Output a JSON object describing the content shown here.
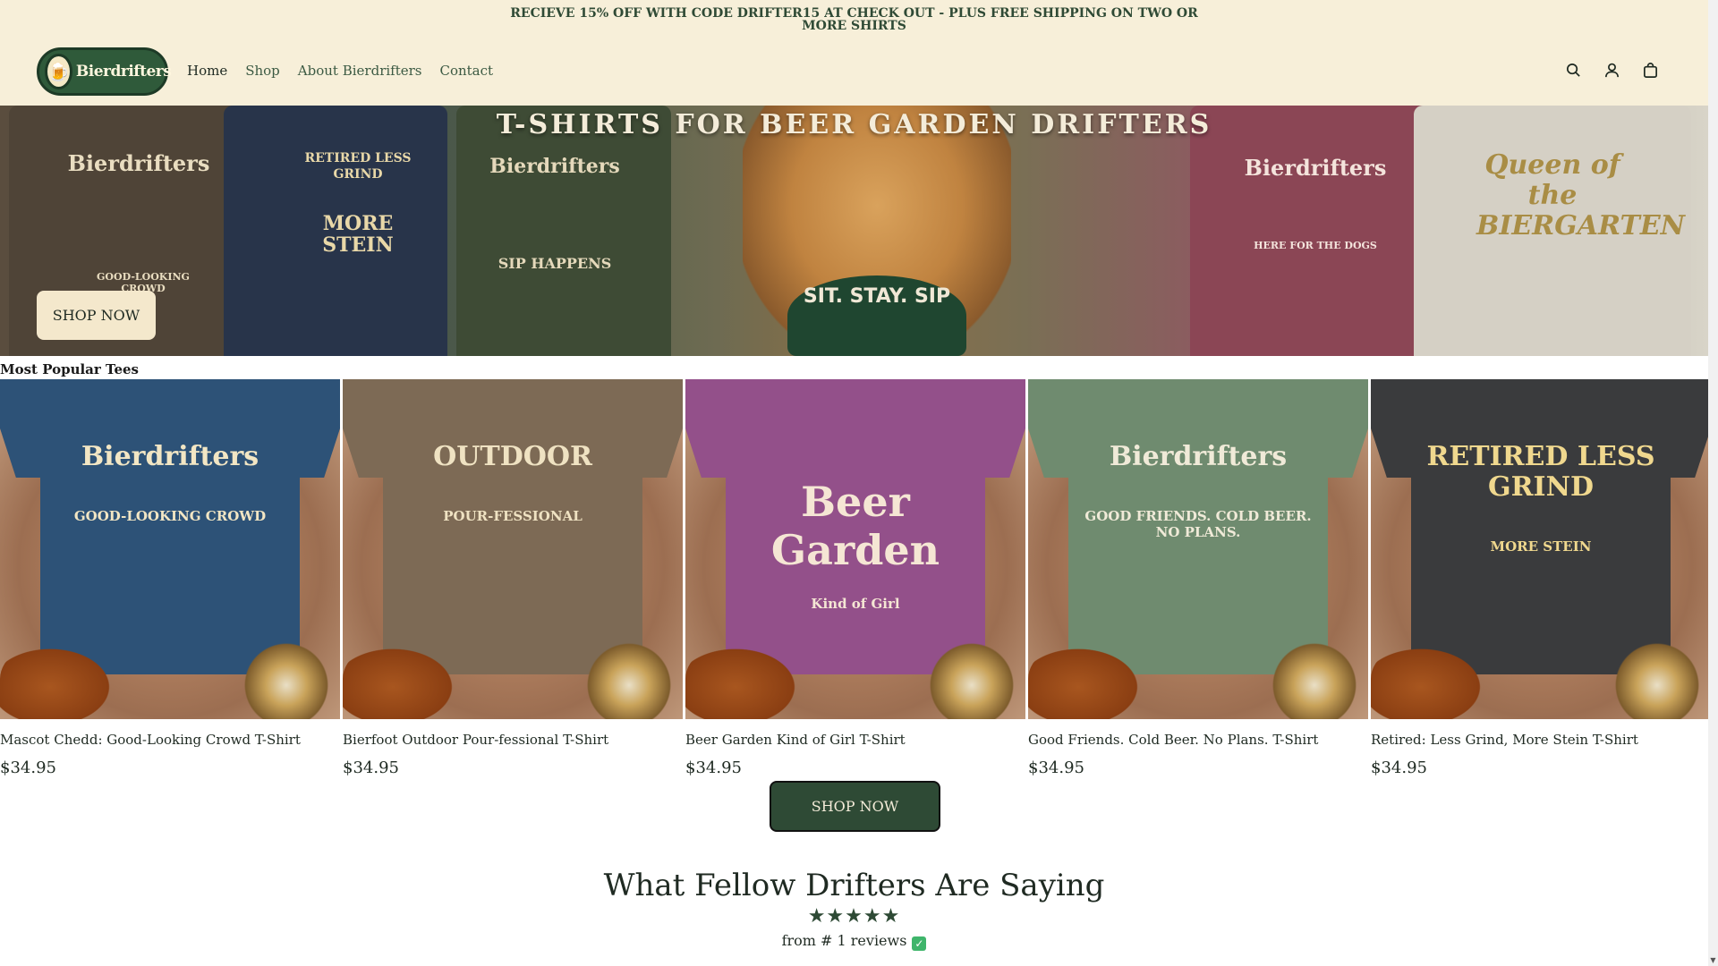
{
  "announcement": {
    "line1": "RECIEVE 15% OFF WITH CODE DRIFTER15 AT CHECK OUT - PLUS FREE SHIPPING ON TWO OR",
    "line2": "MORE SHIRTS"
  },
  "header": {
    "logo_text": "Bierdrifters",
    "nav": [
      {
        "label": "Home",
        "active": true
      },
      {
        "label": "Shop",
        "active": false
      },
      {
        "label": "About Bierdrifters",
        "active": false
      },
      {
        "label": "Contact",
        "active": false
      }
    ],
    "icons": [
      "search-icon",
      "account-icon",
      "cart-icon"
    ]
  },
  "hero": {
    "title": "T-SHIRTS FOR BEER GARDEN DRIFTERS",
    "button_label": "SHOP NOW",
    "shirt_prints": {
      "shirt1_top": "Bierdrifters",
      "shirt1_bottom": "GOOD-LOOKING CROWD",
      "shirt2_top": "RETIRED LESS GRIND",
      "shirt2_bottom": "MORE STEIN",
      "shirt3_top": "Bierdrifters",
      "shirt3_bottom": "SIP HAPPENS",
      "dog_scarf": "SIT. STAY. SIP",
      "shirt4_top": "Bierdrifters",
      "shirt4_bottom": "HERE FOR THE DOGS",
      "shirt5": "Queen of the BIERGARTEN"
    }
  },
  "products_section": {
    "title": "Most Popular Tees",
    "products": [
      {
        "name": "Mascot Chedd: Good-Looking Crowd T-Shirt",
        "price": "$34.95",
        "shirt_color": "#2d5277",
        "print_color": "#f2e6c4",
        "print_a": "Bierdrifters",
        "print_b": "",
        "print_c": "GOOD-LOOKING CROWD"
      },
      {
        "name": "Bierfoot Outdoor Pour-fessional T-Shirt",
        "price": "$34.95",
        "shirt_color": "#7d6a55",
        "print_color": "#efe2c2",
        "print_a": "OUTDOOR",
        "print_b": "",
        "print_c": "POUR-FESSIONAL"
      },
      {
        "name": "Beer Garden Kind of Girl T-Shirt",
        "price": "$34.95",
        "shirt_color": "#93508a",
        "print_color": "#f5e6d4",
        "print_a": "",
        "print_b": "Beer Garden",
        "print_c": "Kind of Girl"
      },
      {
        "name": "Good Friends. Cold Beer. No Plans. T-Shirt",
        "price": "$34.95",
        "shirt_color": "#6f8b6f",
        "print_color": "#f0ead8",
        "print_a": "Bierdrifters",
        "print_b": "",
        "print_c": "GOOD FRIENDS. COLD BEER. NO PLANS."
      },
      {
        "name": "Retired: Less Grind, More Stein T-Shirt",
        "price": "$34.95",
        "shirt_color": "#3a3b3d",
        "print_color": "#f0d88e",
        "print_a": "RETIRED LESS GRIND",
        "print_b": "",
        "print_c": "MORE STEIN"
      }
    ],
    "button_label": "SHOP NOW"
  },
  "reviews": {
    "title": "What Fellow Drifters Are Saying",
    "stars": "★★★★★",
    "count_text": "from # 1 reviews",
    "verified_glyph": "✓"
  },
  "colors": {
    "header_bg": "#f7efd9",
    "brand_green": "#2e4a35",
    "cream": "#f4e8cc"
  }
}
